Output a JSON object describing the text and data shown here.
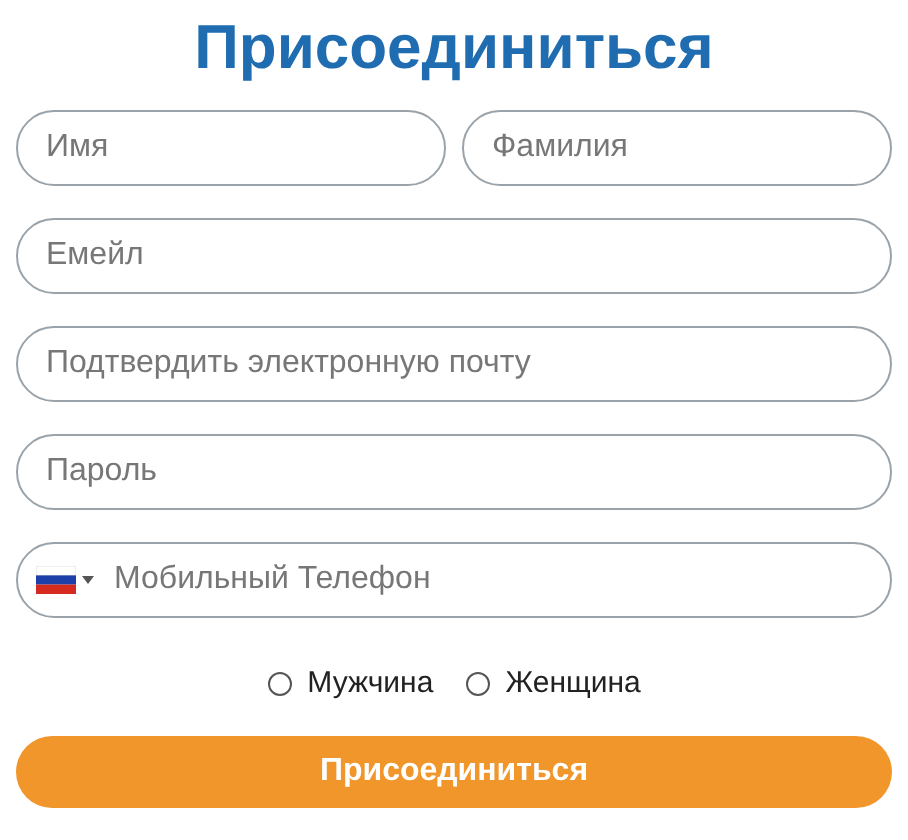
{
  "title": "Присоединиться",
  "name_fields": [
    {
      "placeholder": "Имя"
    },
    {
      "placeholder": "Фамилия"
    }
  ],
  "fields": [
    {
      "placeholder": "Емейл"
    },
    {
      "placeholder": "Подтвердить электронную почту"
    },
    {
      "placeholder": "Пароль"
    }
  ],
  "phone": {
    "placeholder": "Мобильный Телефон"
  },
  "gender": [
    {
      "label": "Мужчина",
      "selected": false
    },
    {
      "label": "Женщина",
      "selected": false
    }
  ],
  "submit": "Присоединиться"
}
